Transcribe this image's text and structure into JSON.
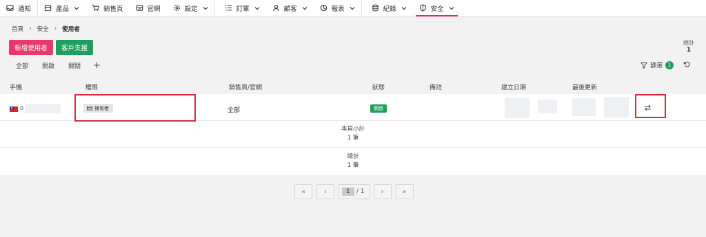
{
  "nav": {
    "items": [
      {
        "label": "通知",
        "icon": "inbox-icon"
      },
      {
        "label": "產品",
        "icon": "box-icon"
      },
      {
        "label": "銷售頁",
        "icon": "cart-icon"
      },
      {
        "label": "官網",
        "icon": "monitor-icon"
      },
      {
        "label": "設定",
        "icon": "gear-icon"
      },
      {
        "label": "訂單",
        "icon": "list-icon"
      },
      {
        "label": "顧客",
        "icon": "user-icon"
      },
      {
        "label": "報表",
        "icon": "pie-chart-icon"
      },
      {
        "label": "紀錄",
        "icon": "database-icon"
      },
      {
        "label": "安全",
        "icon": "shield-icon"
      }
    ],
    "active_color": "#d6315a"
  },
  "breadcrumb": [
    "首頁",
    "安全",
    "使用者"
  ],
  "actions": {
    "add_user": "新增使用者",
    "support": "客戶支援"
  },
  "summary": {
    "total_label": "總計",
    "total_value": "1"
  },
  "tabs": [
    "全部",
    "開啟",
    "關閉",
    "+"
  ],
  "filter": {
    "label": "篩選",
    "count": "1"
  },
  "table": {
    "headers": [
      "手機",
      "權限",
      "銷售頁/官網",
      "狀態",
      "備註",
      "建立日期",
      "最後更新"
    ],
    "rows": [
      {
        "phone_prefix": "0",
        "role": "擁有者",
        "channel": "全部",
        "status": "開啟"
      }
    ],
    "subtotal": {
      "label": "本頁小計",
      "value": "1 筆"
    },
    "total": {
      "label": "總計",
      "value": "1 筆"
    }
  },
  "pagination": {
    "first": "«",
    "prev": "‹",
    "current": "1",
    "separator": "/",
    "total_pages": "1",
    "next": "›",
    "last": "»"
  },
  "colors": {
    "add_button": "#e8386d",
    "support_button": "#1e9f5e",
    "status_open": "#1e9f5e",
    "highlight": "#d62c3c"
  }
}
